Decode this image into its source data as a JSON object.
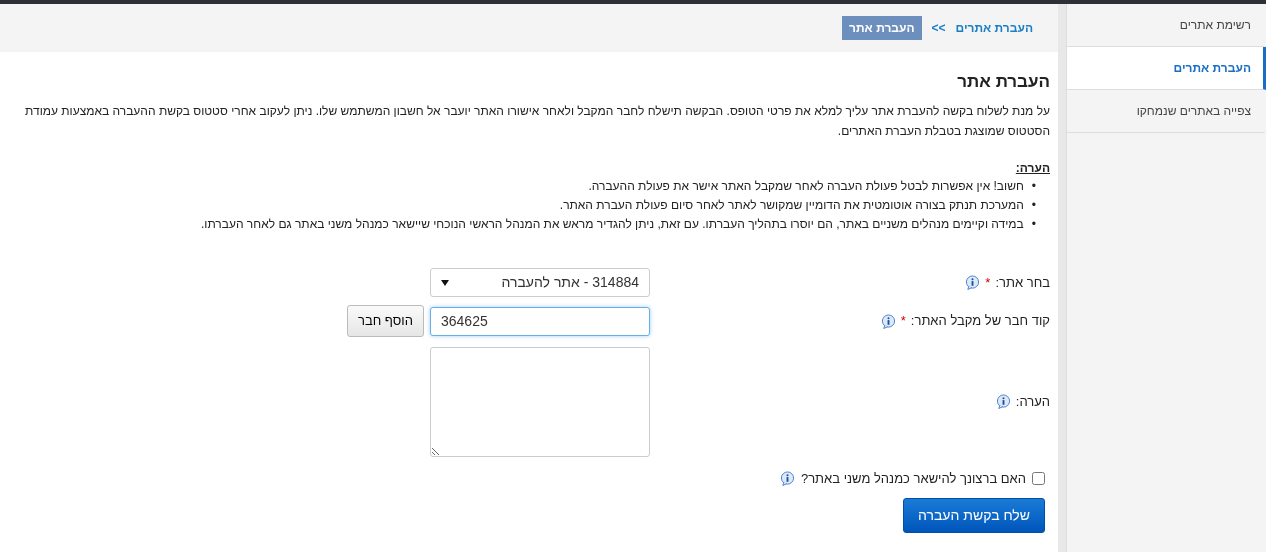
{
  "sidebar": {
    "items": [
      {
        "label": "רשימת אתרים",
        "selected": false
      },
      {
        "label": "העברת אתרים",
        "selected": true
      },
      {
        "label": "צפייה באתרים שנמחקו",
        "selected": false
      }
    ]
  },
  "breadcrumb": {
    "link": "העברת אתרים",
    "separator": ">>",
    "current": "העברת אתר"
  },
  "title": "העברת אתר",
  "intro": "על מנת לשלוח בקשה להעברת אתר עליך למלא את פרטי הטופס. הבקשה תישלח לחבר המקבל ולאחר אישורו האתר יועבר אל חשבון המשתמש שלו. ניתן לעקוב אחרי סטטוס בקשת ההעברה באמצעות עמודת הסטטוס שמוצגת בטבלת העברת האתרים.",
  "note": {
    "heading": "הערה:",
    "marker": "•",
    "items": [
      "חשוב! אין אפשרות לבטל פעולת העברה לאחר שמקבל האתר אישר את פעולת ההעברה.",
      "המערכת תנתק בצורה אוטומטית את הדומיין שמקושר לאתר לאחר סיום פעולת העברת האתר.",
      "במידה וקיימים מנהלים משניים באתר, הם יוסרו בתהליך העברתו. עם זאת, ניתן להגדיר מראש את המנהל הראשי הנוכחי שיישאר כמנהל משני באתר גם לאחר העברתו."
    ]
  },
  "form": {
    "site": {
      "label": "בחר אתר:",
      "required_mark": "*",
      "value": "314884 - אתר להעברה"
    },
    "member_code": {
      "label": "קוד חבר של מקבל האתר:",
      "required_mark": "*",
      "value": "364625",
      "button": "הוסף חבר"
    },
    "comment": {
      "label": "הערה:"
    },
    "stay_admin": {
      "label": "האם ברצונך להישאר כמנהל משני באתר?",
      "checked": false
    },
    "submit": "שלח בקשת העברה"
  }
}
